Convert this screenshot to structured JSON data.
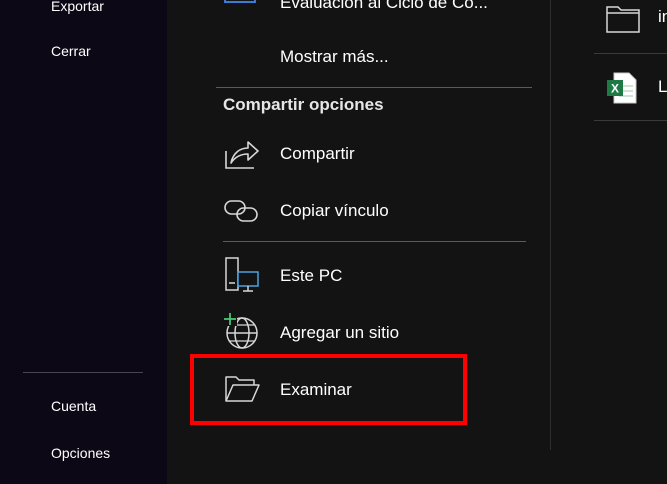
{
  "sidebar": {
    "items": [
      {
        "label": "Exportar"
      },
      {
        "label": "Cerrar"
      },
      {
        "label": "Cuenta"
      },
      {
        "label": "Opciones"
      }
    ]
  },
  "main": {
    "recent_item": {
      "label": "Evaluación al Ciclo de Co...",
      "icon": "word-doc-icon"
    },
    "show_more": {
      "label": "Mostrar más..."
    },
    "share_section": {
      "title": "Compartir opciones",
      "share": {
        "label": "Compartir",
        "icon": "share-icon"
      },
      "copy_link": {
        "label": "Copiar vínculo",
        "icon": "link-icon"
      }
    },
    "locations": {
      "this_pc": {
        "label": "Este PC",
        "icon": "computer-icon"
      },
      "add_place": {
        "label": "Agregar un sitio",
        "icon": "globe-add-icon"
      },
      "browse": {
        "label": "Examinar",
        "icon": "folder-open-icon"
      }
    }
  },
  "right_panel": {
    "items": [
      {
        "label": "in",
        "icon": "folder-icon"
      },
      {
        "label": "L",
        "icon": "excel-file-icon"
      }
    ]
  },
  "colors": {
    "sidebar_bg": "#0d0815",
    "main_bg": "#131313",
    "highlight": "#ff0000",
    "excel_green": "#1d7a45"
  }
}
